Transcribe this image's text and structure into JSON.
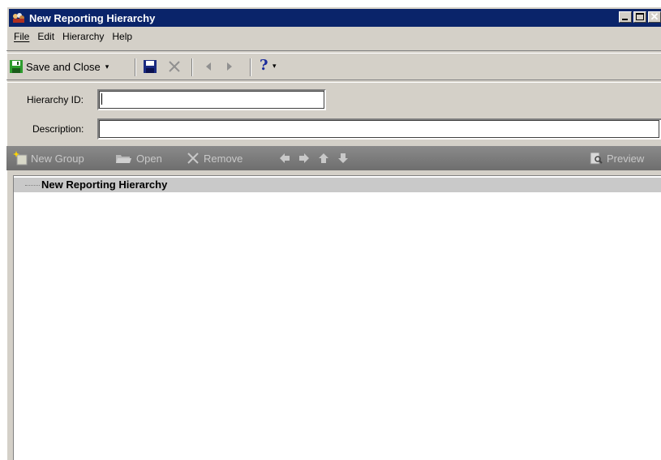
{
  "window": {
    "title": "New Reporting Hierarchy"
  },
  "menu": [
    "File",
    "Edit",
    "Hierarchy",
    "Help"
  ],
  "toolbar": {
    "save_close_label": "Save and Close"
  },
  "form": {
    "hierarchy_id_label": "Hierarchy ID:",
    "hierarchy_id_value": "",
    "description_label": "Description:",
    "description_value": ""
  },
  "group_toolbar": {
    "new_group": "New Group",
    "open": "Open",
    "remove": "Remove",
    "preview": "Preview"
  },
  "tree": {
    "root": "New Reporting Hierarchy"
  }
}
